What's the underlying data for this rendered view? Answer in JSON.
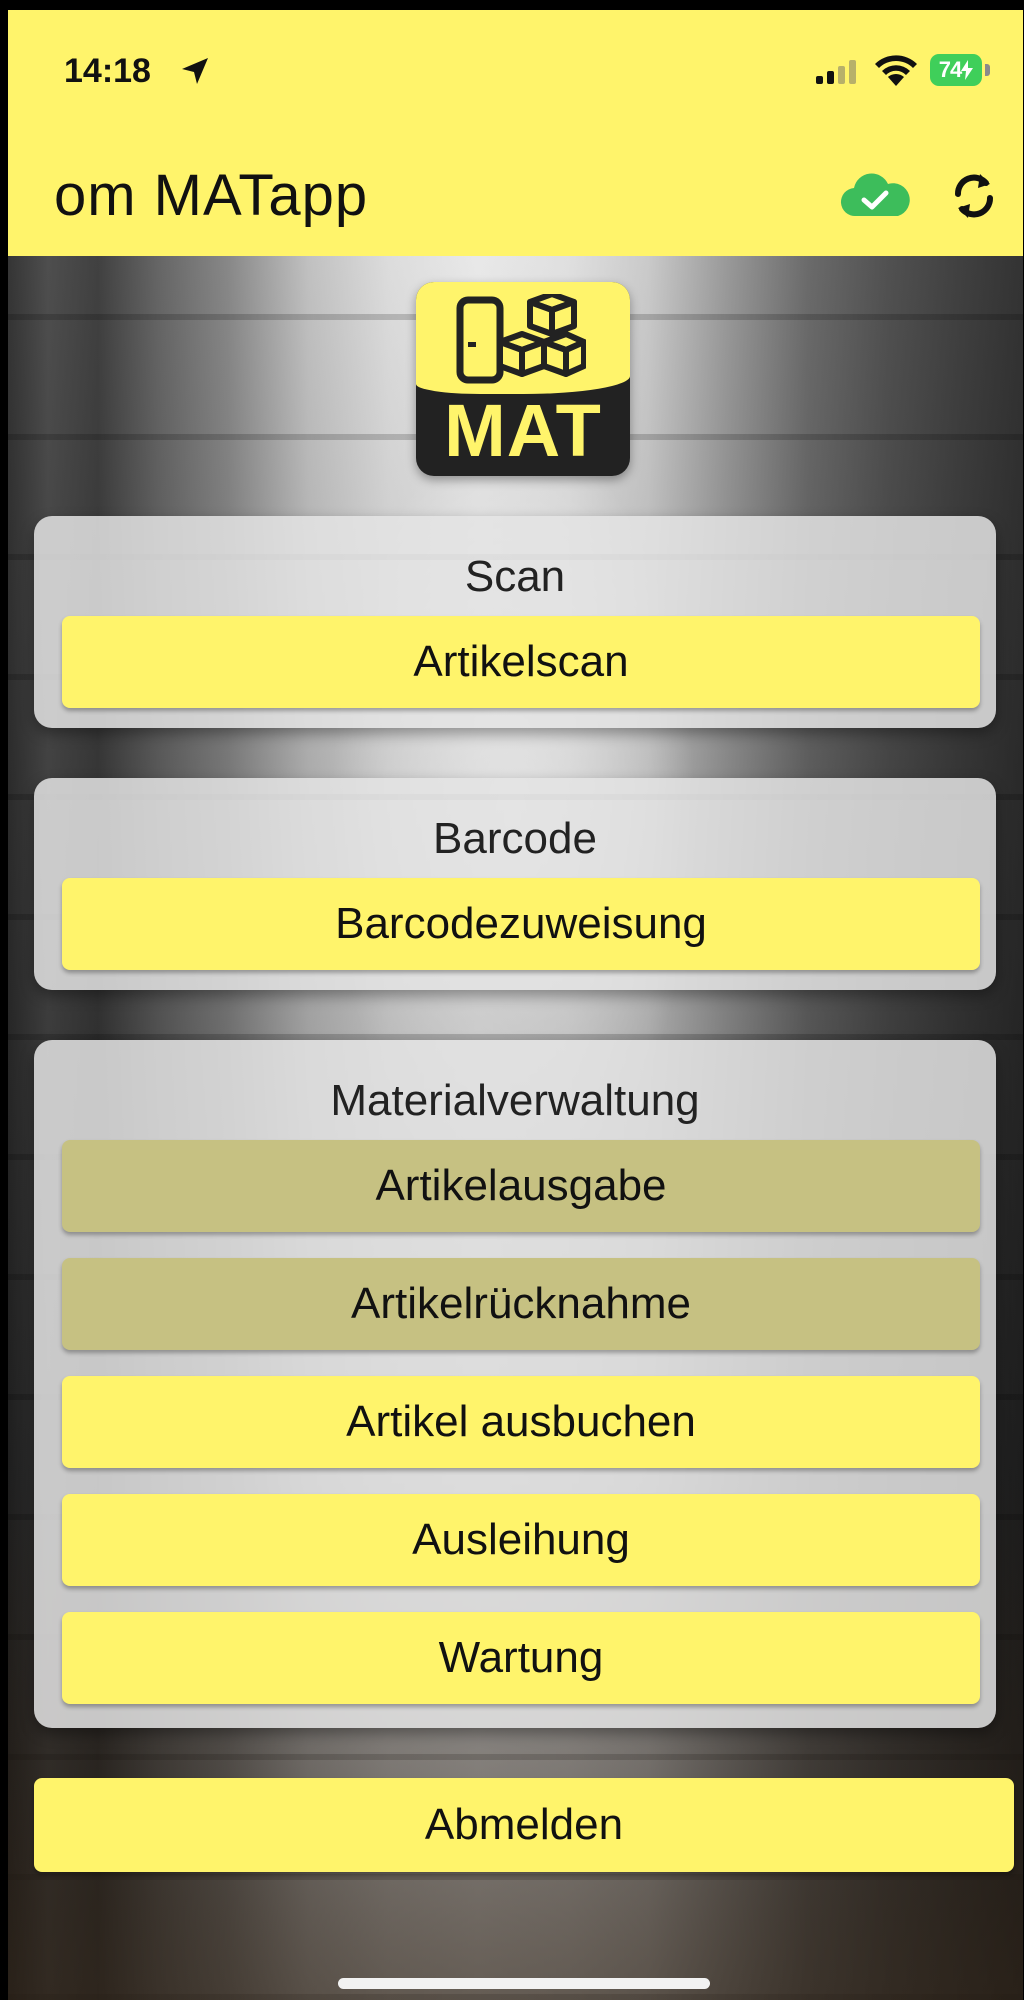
{
  "status_bar": {
    "time": "14:18",
    "battery": "74",
    "icons": [
      "location-arrow-icon",
      "signal-icon",
      "wifi-icon",
      "battery-charging-icon"
    ]
  },
  "header": {
    "title": "om MATapp",
    "icons": [
      "cloud-check-icon",
      "sync-icon"
    ],
    "background_color": "#fff46b",
    "cloud_color": "#3dbd5b"
  },
  "logo": {
    "text": "MAT"
  },
  "sections": [
    {
      "title": "Scan",
      "buttons": [
        {
          "label": "Artikelscan",
          "enabled": true
        }
      ]
    },
    {
      "title": "Barcode",
      "buttons": [
        {
          "label": "Barcodezuweisung",
          "enabled": true
        }
      ]
    },
    {
      "title": "Materialverwaltung",
      "buttons": [
        {
          "label": "Artikelausgabe",
          "enabled": false
        },
        {
          "label": "Artikelrücknahme",
          "enabled": false
        },
        {
          "label": "Artikel ausbuchen",
          "enabled": true
        },
        {
          "label": "Ausleihung",
          "enabled": true
        },
        {
          "label": "Wartung",
          "enabled": true
        }
      ]
    }
  ],
  "logout_label": "Abmelden",
  "colors": {
    "button": "#fff46b",
    "button_disabled": "#c6c182"
  }
}
